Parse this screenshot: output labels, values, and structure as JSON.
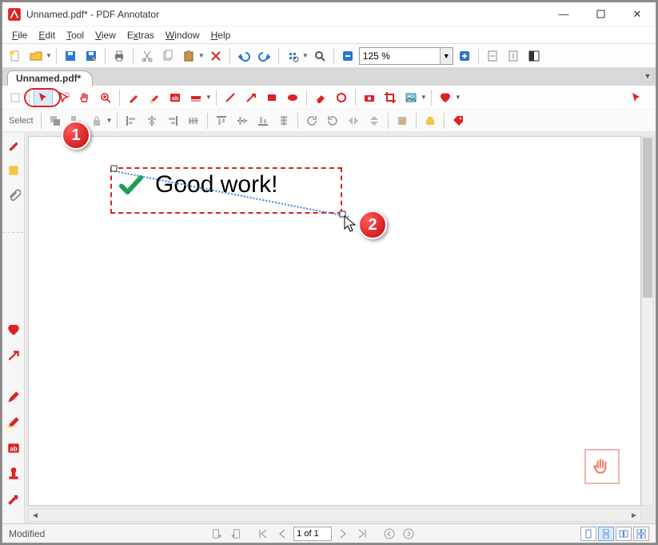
{
  "window": {
    "title": "Unnamed.pdf* - PDF Annotator"
  },
  "menus": {
    "file": "File",
    "edit": "Edit",
    "tool": "Tool",
    "view": "View",
    "extras": "Extras",
    "window": "Window",
    "help": "Help"
  },
  "zoom": {
    "value": "125 %"
  },
  "tab": {
    "label": "Unnamed.pdf*"
  },
  "toolbox2": {
    "select_label": "Select"
  },
  "annotation": {
    "text": "Good work!"
  },
  "callouts": {
    "one": "1",
    "two": "2"
  },
  "status": {
    "left": "Modified",
    "page_of": "1 of 1"
  }
}
